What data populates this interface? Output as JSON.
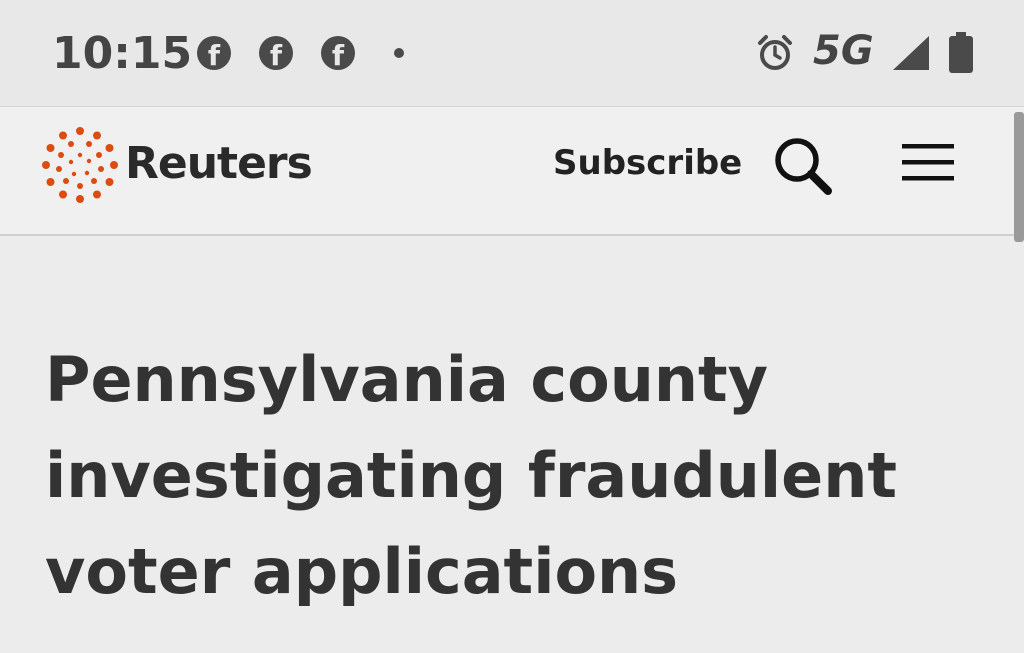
{
  "status_bar": {
    "time": "10:15",
    "notification_icons": [
      "facebook-icon",
      "facebook-icon",
      "facebook-icon"
    ],
    "network": "5G",
    "icons": [
      "alarm-icon",
      "signal-icon",
      "battery-icon"
    ]
  },
  "header": {
    "brand": "Reuters",
    "subscribe_label": "Subscribe",
    "brand_color": "#dc4b12"
  },
  "article": {
    "headline": "Pennsylvania county investigating fraudulent voter applications"
  }
}
